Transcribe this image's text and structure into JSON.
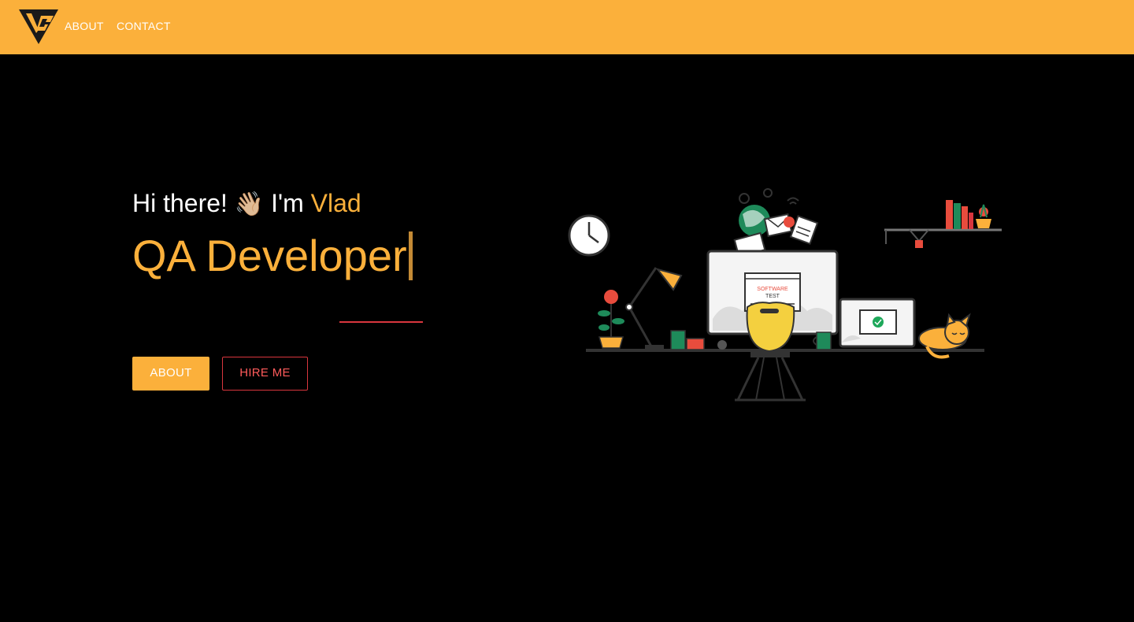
{
  "nav": {
    "logo_text": "VG",
    "about_label": "ABOUT",
    "contact_label": "CONTACT"
  },
  "hero": {
    "greeting_prefix": "Hi there!",
    "wave_emoji": "👋🏼",
    "greeting_im": "I'm",
    "name": "Vlad",
    "role": "QA Developer",
    "about_button": "ABOUT",
    "hire_button": "HIRE ME"
  },
  "illustration": {
    "screen_title": "SOFTWARE",
    "screen_subtitle": "TEST"
  },
  "colors": {
    "accent": "#fbb03b",
    "navbar": "#fbb03b",
    "background": "#000000",
    "secondary": "#d9363e"
  }
}
